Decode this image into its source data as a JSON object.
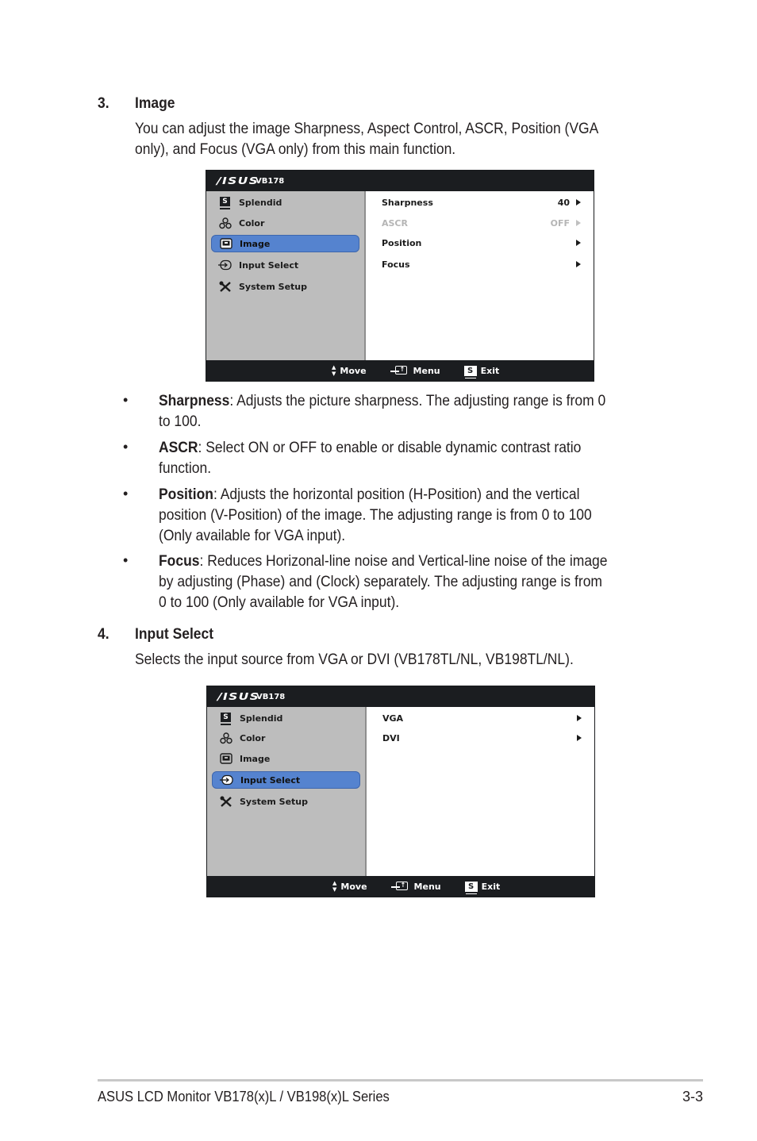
{
  "sections": [
    {
      "number": "3.",
      "title": "Image",
      "description_lines": [
        "You can adjust the image Sharpness, Aspect Control, ASCR, Position (VGA",
        "only), and Focus (VGA only) from this main function."
      ],
      "osd": {
        "brand": "/ISUS",
        "model": "VB178",
        "menu": [
          {
            "label": "Splendid",
            "icon": "splendid-s-icon",
            "active": false
          },
          {
            "label": "Color",
            "icon": "color-circles-icon",
            "active": false
          },
          {
            "label": "Image",
            "icon": "image-icon",
            "active": true
          },
          {
            "label": "Input Select",
            "icon": "input-select-icon",
            "active": false
          },
          {
            "label": "System Setup",
            "icon": "wrench-screwdriver-icon",
            "active": false
          }
        ],
        "submenu": [
          {
            "label": "Sharpness",
            "value": "40",
            "disabled": false
          },
          {
            "label": "ASCR",
            "value": "OFF",
            "disabled": true
          },
          {
            "label": "Position",
            "value": "",
            "disabled": false
          },
          {
            "label": "Focus",
            "value": "",
            "disabled": false
          }
        ],
        "footer": {
          "move": "Move",
          "menu": "Menu",
          "exit": "Exit",
          "exit_key": "S"
        }
      },
      "bullets": [
        {
          "term": "Sharpness",
          "lines": [
            ": Adjusts the picture sharpness. The adjusting range is from 0",
            "to 100."
          ]
        },
        {
          "term": "ASCR",
          "lines": [
            ": Select ON or OFF to enable or disable dynamic contrast ratio",
            "function."
          ]
        },
        {
          "term": "Position",
          "lines": [
            ": Adjusts the horizontal position (H-Position) and the vertical",
            "position (V-Position) of the image. The adjusting range is from 0 to 100",
            "(Only available for VGA input)."
          ]
        },
        {
          "term": "Focus",
          "lines": [
            ": Reduces Horizonal-line noise and Vertical-line noise of the image",
            "by adjusting (Phase) and (Clock) separately. The adjusting range is from",
            "0 to 100 (Only available for VGA input)."
          ]
        }
      ]
    },
    {
      "number": "4.",
      "title": "Input Select",
      "description_lines": [
        "Selects the input source from VGA or DVI (VB178TL/NL, VB198TL/NL)."
      ],
      "osd": {
        "brand": "/ISUS",
        "model": "VB178",
        "menu": [
          {
            "label": "Splendid",
            "icon": "splendid-s-icon",
            "active": false
          },
          {
            "label": "Color",
            "icon": "color-circles-icon",
            "active": false
          },
          {
            "label": "Image",
            "icon": "image-icon",
            "active": false
          },
          {
            "label": "Input Select",
            "icon": "input-select-icon",
            "active": true
          },
          {
            "label": "System Setup",
            "icon": "wrench-screwdriver-icon",
            "active": false
          }
        ],
        "submenu": [
          {
            "label": "VGA",
            "value": "",
            "disabled": false
          },
          {
            "label": "DVI",
            "value": "",
            "disabled": false
          }
        ],
        "footer": {
          "move": "Move",
          "menu": "Menu",
          "exit": "Exit",
          "exit_key": "S"
        }
      }
    }
  ],
  "bullet_glyph": "•",
  "page_footer": {
    "left": "ASUS LCD Monitor VB178(x)L / VB198(x)L Series",
    "right": "3-3"
  },
  "colors": {
    "osd_header": "#1b1d20",
    "osd_sidebar": "#bdbdbd",
    "osd_active": "#5583cf",
    "disabled_text": "#b5b5b5"
  }
}
